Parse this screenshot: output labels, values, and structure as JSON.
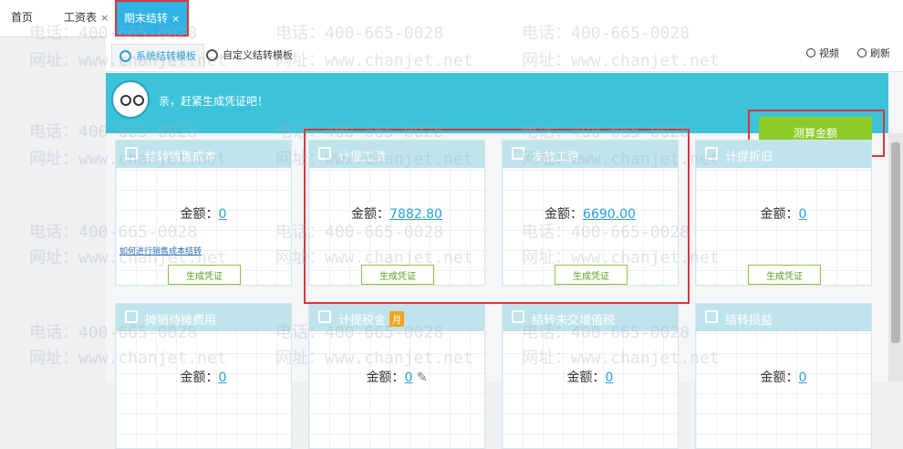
{
  "top_tabs": [
    {
      "label": "首页",
      "closable": false
    },
    {
      "label": "工资表",
      "closable": true
    },
    {
      "label": "期末结转",
      "closable": true,
      "active": true
    }
  ],
  "close_glyph": "×",
  "watermark": {
    "phone": "电话：400-665-0028",
    "site": "网址：www.chanjet.net"
  },
  "sub_tabs": [
    {
      "label": "系统结转模板",
      "icon": "template-icon",
      "active": true
    },
    {
      "label": "自定义结转模板",
      "icon": "custom-template-icon",
      "active": false
    }
  ],
  "tools": {
    "video": "视频",
    "refresh": "刷新"
  },
  "banner": {
    "message": "亲，赶紧生成凭证吧！",
    "calc_button": "测算金额"
  },
  "amount_label": "金额：",
  "generate_label": "生成凭证",
  "cards": [
    {
      "title": "结转销售成本",
      "amount": "0",
      "link": "如何进行销售成本结转",
      "icon": "cost-icon"
    },
    {
      "title": "计提工资",
      "amount": "7882.80",
      "icon": "salary-icon"
    },
    {
      "title": "发放工资",
      "amount": "6690.00",
      "icon": "pay-icon"
    },
    {
      "title": "计提折旧",
      "amount": "0",
      "icon": "depreciation-icon"
    },
    {
      "title": "摊销待摊费用",
      "amount": "0",
      "icon": "amortize-icon"
    },
    {
      "title": "计提税金",
      "amount": "0",
      "badge": "月",
      "icon": "tax-icon"
    },
    {
      "title": "结转未交增值税",
      "amount": "0",
      "icon": "vat-icon"
    },
    {
      "title": "结转损益",
      "amount": "0",
      "icon": "profit-loss-icon"
    }
  ],
  "colors": {
    "accent": "#2fb2e4",
    "banner": "#3cc3d9",
    "calc_button": "#8ccb2a",
    "highlight": "#d9363e",
    "card_head": "#bfe4ec"
  }
}
